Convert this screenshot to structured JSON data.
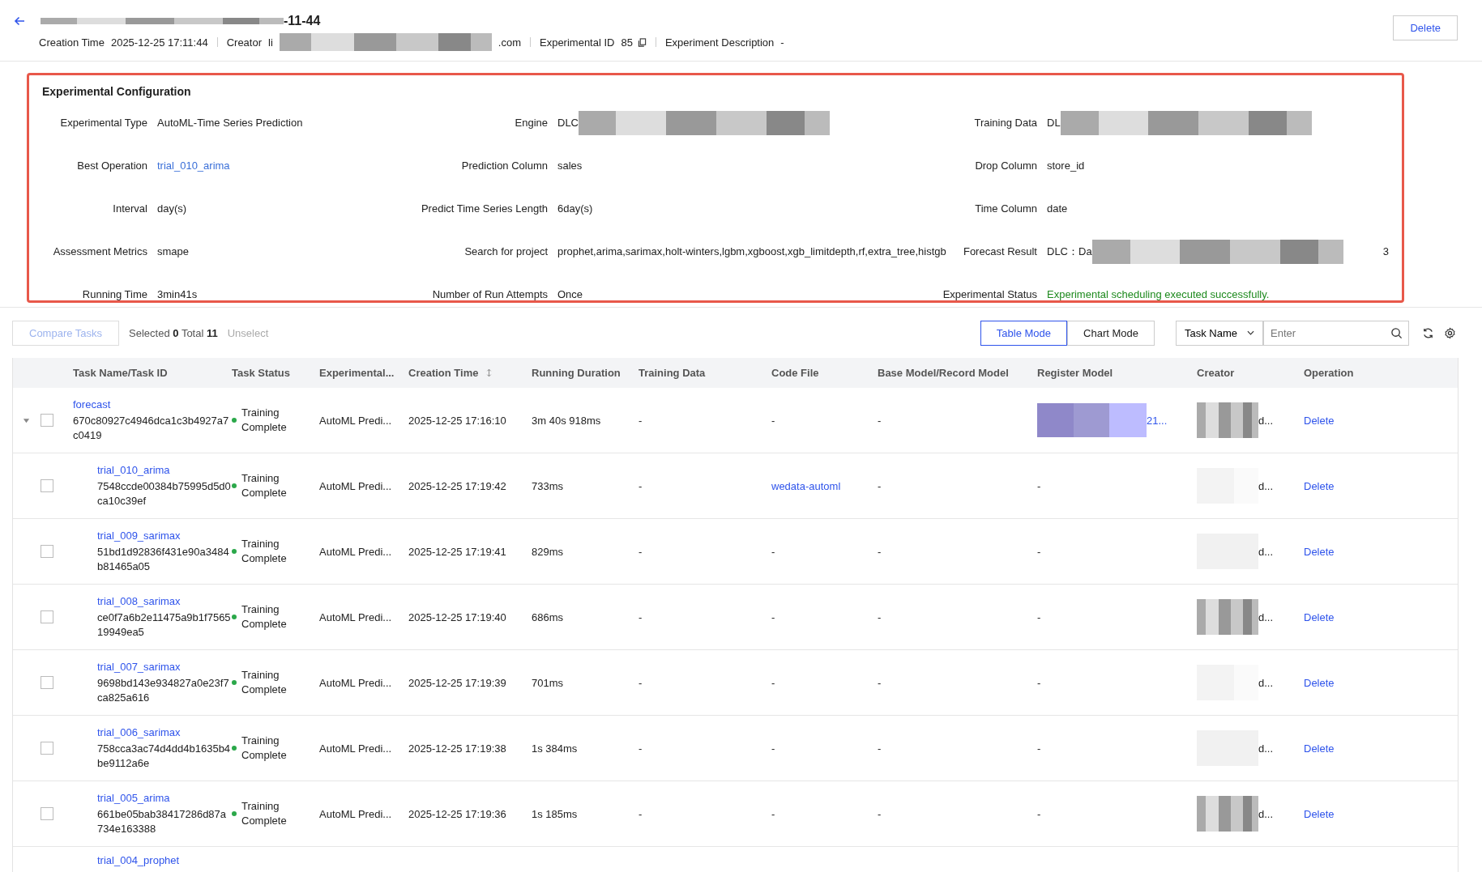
{
  "header": {
    "title_suffix": "-11-44",
    "meta": [
      {
        "label": "Creation Time",
        "value": "2025-12-25 17:11:44",
        "kind": "text"
      },
      {
        "label": "Creator",
        "prefix": "li",
        "suffix": ".com",
        "kind": "redacted"
      },
      {
        "label": "Experimental ID",
        "value": "85",
        "kind": "copy"
      },
      {
        "label": "Experiment Description",
        "value": "-",
        "kind": "text"
      }
    ],
    "delete_button": "Delete"
  },
  "config": {
    "title": "Experimental Configuration",
    "fields": [
      {
        "label": "Experimental Type",
        "value": "AutoML-Time Series Prediction",
        "kind": "text"
      },
      {
        "label": "Engine",
        "value": "DLC",
        "kind": "redacted"
      },
      {
        "label": "Training Data",
        "value": "DL",
        "kind": "redacted"
      },
      {
        "label": "Best Operation",
        "value": "trial_010_arima",
        "kind": "link"
      },
      {
        "label": "Prediction Column",
        "value": "sales",
        "kind": "text"
      },
      {
        "label": "Drop Column",
        "value": "store_id",
        "kind": "text"
      },
      {
        "label": "Interval",
        "value": "day(s)",
        "kind": "text"
      },
      {
        "label": "Predict Time Series Length",
        "value": "6day(s)",
        "kind": "text"
      },
      {
        "label": "Time Column",
        "value": "date",
        "kind": "text"
      },
      {
        "label": "Assessment Metrics",
        "value": "smape",
        "kind": "text"
      },
      {
        "label": "Search for project",
        "value": "prophet,arima,sarimax,holt-winters,lgbm,xgboost,xgb_limitdepth,rf,extra_tree,histgb",
        "kind": "text"
      },
      {
        "label": "Forecast Result",
        "value": "DLC：Da",
        "suffix": "3",
        "kind": "redacted"
      },
      {
        "label": "Running Time",
        "value": "3min41s",
        "kind": "text"
      },
      {
        "label": "Number of Run Attempts",
        "value": "Once",
        "kind": "text"
      },
      {
        "label": "Experimental Status",
        "value": "Experimental scheduling executed successfully.",
        "kind": "success"
      }
    ]
  },
  "toolbar": {
    "compare_button": {
      "label": "Compare Tasks",
      "disabled": true
    },
    "selection": "Selected **0** Total **11**",
    "unselect": {
      "label": "Unselect",
      "disabled": true
    },
    "modes": [
      {
        "label": "Table Mode",
        "selected": true
      },
      {
        "label": "Chart Mode",
        "selected": false
      }
    ],
    "search_field": {
      "label": "Task Name",
      "placeholder": "Enter"
    }
  },
  "table": {
    "columns": [
      "Task Name/Task ID",
      "Task Status",
      "Experimental...",
      "Creation Time",
      "Running Duration",
      "Training Data",
      "Code File",
      "Base Model/Record Model",
      "Register Model",
      "Creator",
      "Operation"
    ],
    "rows": [
      {
        "name": "forecast",
        "id": "670c80927c4946dca1c3b4927a7c0419",
        "checked": false,
        "expanded": true,
        "status": "Training Complete",
        "color": "#2ba84a",
        "type": "AutoML Predi...",
        "created": "2025-12-25 17:16:10",
        "duration": "3m 40s 918ms",
        "training_data": "-",
        "code_file": {
          "text": "-",
          "kind": "text"
        },
        "base_model": "-",
        "register_model": {
          "text": "21...",
          "kind": "redacted"
        },
        "creator": "d...",
        "operation": "Delete",
        "children": [
          {
            "name": "trial_010_arima",
            "id": "7548ccde00384b75995d5d0ca10c39ef",
            "checked": false,
            "status": "Training Complete",
            "color": "#2ba84a",
            "type": "AutoML Predi...",
            "created": "2025-12-25 17:19:42",
            "duration": "733ms",
            "training_data": "-",
            "code_file": {
              "text": "wedata-automl",
              "kind": "link"
            },
            "base_model": "-",
            "register_model": {
              "text": "-",
              "kind": "text"
            },
            "creator": "d...",
            "operation": "Delete"
          },
          {
            "name": "trial_009_sarimax",
            "id": "51bd1d92836f431e90a3484b81465a05",
            "checked": false,
            "status": "Training Complete",
            "color": "#2ba84a",
            "type": "AutoML Predi...",
            "created": "2025-12-25 17:19:41",
            "duration": "829ms",
            "training_data": "-",
            "code_file": {
              "text": "-",
              "kind": "text"
            },
            "base_model": "-",
            "register_model": {
              "text": "-",
              "kind": "text"
            },
            "creator": "d...",
            "operation": "Delete"
          },
          {
            "name": "trial_008_sarimax",
            "id": "ce0f7a6b2e11475a9b1f756519949ea5",
            "checked": false,
            "status": "Training Complete",
            "color": "#2ba84a",
            "type": "AutoML Predi...",
            "created": "2025-12-25 17:19:40",
            "duration": "686ms",
            "training_data": "-",
            "code_file": {
              "text": "-",
              "kind": "text"
            },
            "base_model": "-",
            "register_model": {
              "text": "-",
              "kind": "text"
            },
            "creator": "d...",
            "operation": "Delete"
          },
          {
            "name": "trial_007_sarimax",
            "id": "9698bd143e934827a0e23f7ca825a616",
            "checked": false,
            "status": "Training Complete",
            "color": "#2ba84a",
            "type": "AutoML Predi...",
            "created": "2025-12-25 17:19:39",
            "duration": "701ms",
            "training_data": "-",
            "code_file": {
              "text": "-",
              "kind": "text"
            },
            "base_model": "-",
            "register_model": {
              "text": "-",
              "kind": "text"
            },
            "creator": "d...",
            "operation": "Delete"
          },
          {
            "name": "trial_006_sarimax",
            "id": "758cca3ac74d4dd4b1635b4be9112a6e",
            "checked": false,
            "status": "Training Complete",
            "color": "#2ba84a",
            "type": "AutoML Predi...",
            "created": "2025-12-25 17:19:38",
            "duration": "1s 384ms",
            "training_data": "-",
            "code_file": {
              "text": "-",
              "kind": "text"
            },
            "base_model": "-",
            "register_model": {
              "text": "-",
              "kind": "text"
            },
            "creator": "d...",
            "operation": "Delete"
          },
          {
            "name": "trial_005_arima",
            "id": "661be05bab38417286d87a734e163388",
            "checked": false,
            "status": "Training Complete",
            "color": "#2ba84a",
            "type": "AutoML Predi...",
            "created": "2025-12-25 17:19:36",
            "duration": "1s 185ms",
            "training_data": "-",
            "code_file": {
              "text": "-",
              "kind": "text"
            },
            "base_model": "-",
            "register_model": {
              "text": "-",
              "kind": "text"
            },
            "creator": "d...",
            "operation": "Delete"
          }
        ]
      }
    ],
    "partial_row": {
      "name": "trial_004_prophet"
    }
  }
}
